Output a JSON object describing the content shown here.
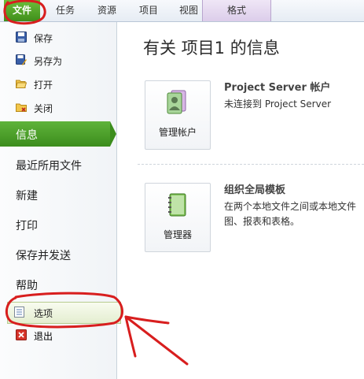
{
  "ribbon": {
    "tabs": [
      "文件",
      "任务",
      "资源",
      "项目",
      "视图",
      "格式"
    ]
  },
  "sidebar": {
    "small_items": [
      "保存",
      "另存为",
      "打开",
      "关闭"
    ],
    "info": "信息",
    "big_items": [
      "最近所用文件",
      "新建",
      "打印",
      "保存并发送",
      "帮助"
    ],
    "options": "选项",
    "exit": "退出"
  },
  "main": {
    "title": "有关 项目1 的信息",
    "sections": [
      {
        "button": "管理帐户",
        "title": "Project Server 帐户",
        "lines": [
          "未连接到 Project Server"
        ]
      },
      {
        "button": "管理器",
        "title": "组织全局模板",
        "lines": [
          "在两个本地文件之间或本地文件",
          "图、报表和表格。"
        ]
      }
    ]
  },
  "colors": {
    "accent_green": "#4a9e27",
    "annotation_red": "#d81e1e",
    "format_tab": "#dccdea"
  },
  "icons": [
    "save-icon",
    "save-as-icon",
    "open-folder-icon",
    "close-folder-icon",
    "options-icon",
    "exit-icon",
    "account-icon",
    "organizer-icon"
  ]
}
